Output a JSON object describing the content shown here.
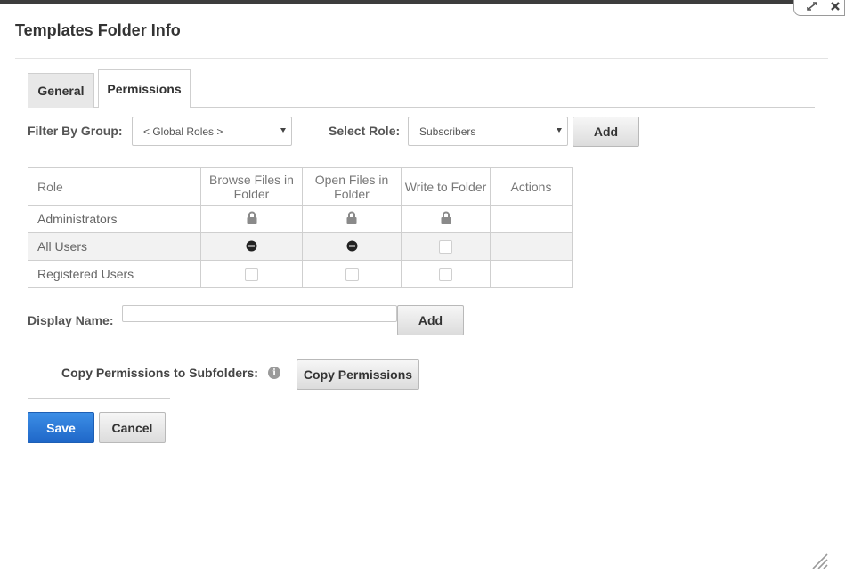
{
  "dialog": {
    "title": "Templates Folder Info"
  },
  "tabs": [
    {
      "label": "General",
      "active": false
    },
    {
      "label": "Permissions",
      "active": true
    }
  ],
  "filter": {
    "label": "Filter By Group:",
    "selected": "< Global Roles >"
  },
  "role_select": {
    "label": "Select Role:",
    "selected": "Subscribers",
    "add_label": "Add"
  },
  "permissions_table": {
    "headers": [
      "Role",
      "Browse Files in Folder",
      "Open Files in Folder",
      "Write to Folder",
      "Actions"
    ],
    "rows": [
      {
        "role": "Administrators",
        "browse": "locked",
        "open": "locked",
        "write": "locked"
      },
      {
        "role": "All Users",
        "browse": "denied",
        "open": "denied",
        "write": "unchecked"
      },
      {
        "role": "Registered Users",
        "browse": "unchecked",
        "open": "unchecked",
        "write": "unchecked"
      }
    ]
  },
  "display_name": {
    "label": "Display Name:",
    "value": "",
    "add_label": "Add"
  },
  "copy_permissions": {
    "label": "Copy Permissions to Subfolders:",
    "button_label": "Copy Permissions"
  },
  "actions": {
    "save_label": "Save",
    "cancel_label": "Cancel"
  },
  "colors": {
    "primary": "#2a78d6",
    "window_border": "#3d3d3d"
  }
}
